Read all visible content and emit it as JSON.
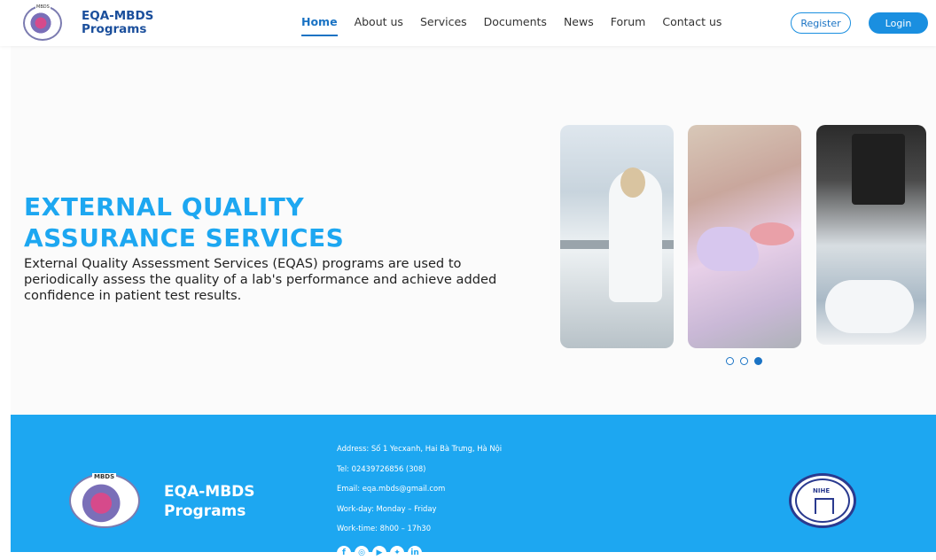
{
  "header": {
    "logo_badge": "MBDS",
    "brand_line1": "EQA-MBDS",
    "brand_line2": "Programs",
    "nav": [
      {
        "label": "Home",
        "active": true
      },
      {
        "label": "About us",
        "active": false
      },
      {
        "label": "Services",
        "active": false
      },
      {
        "label": "Documents",
        "active": false
      },
      {
        "label": "News",
        "active": false
      },
      {
        "label": "Forum",
        "active": false
      },
      {
        "label": "Contact us",
        "active": false
      }
    ],
    "register_label": "Register",
    "login_label": "Login"
  },
  "hero": {
    "title_line1": "EXTERNAL QUALITY",
    "title_line2": "ASSURANCE SERVICES",
    "description": "External Quality Assessment Services (EQAS) programs are used to periodically assess the quality of a lab's performance and achieve added confidence in patient test results.",
    "slide_count": 3,
    "active_slide_index": 2
  },
  "footer": {
    "logo_badge": "MBDS",
    "brand_line1": "EQA-MBDS",
    "brand_line2": "Programs",
    "address": "Address: Số 1 Yecxanh, Hai Bà Trưng, Hà Nội",
    "tel": "Tel: 02439726856 (308)",
    "email": "Email: eqa.mbds@gmail.com",
    "workday": "Work-day: Monday – Friday",
    "worktime": "Work-time: 8h00 – 17h30",
    "nihe_label": "NIHE",
    "socials": [
      "facebook-icon",
      "instagram-icon",
      "youtube-icon",
      "twitter-icon",
      "linkedin-icon"
    ]
  },
  "colors": {
    "accent": "#1da7f1",
    "nav_active": "#1a73c4",
    "brand_dark": "#1b4f9c"
  }
}
